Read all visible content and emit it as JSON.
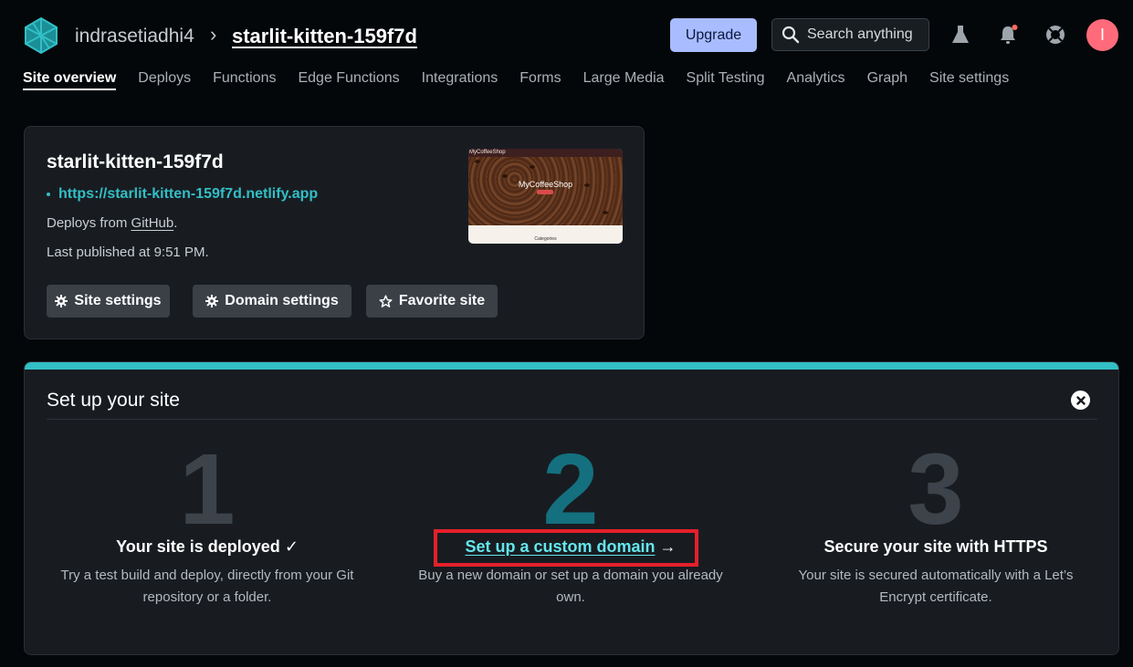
{
  "header": {
    "team_name": "indrasetiadhi4",
    "separator": "›",
    "site_name": "starlit-kitten-159f7d",
    "upgrade_label": "Upgrade",
    "search_label": "Search anything",
    "avatar_initial": "I",
    "notification_dot_color": "#ff6b5b"
  },
  "tabs": [
    {
      "label": "Site overview",
      "active": true
    },
    {
      "label": "Deploys"
    },
    {
      "label": "Functions"
    },
    {
      "label": "Edge Functions"
    },
    {
      "label": "Integrations"
    },
    {
      "label": "Forms"
    },
    {
      "label": "Large Media"
    },
    {
      "label": "Split Testing"
    },
    {
      "label": "Analytics"
    },
    {
      "label": "Graph"
    },
    {
      "label": "Site settings"
    }
  ],
  "site_card": {
    "name": "starlit-kitten-159f7d",
    "url": "https://starlit-kitten-159f7d.netlify.app",
    "deploys_from_prefix": "Deploys from",
    "deploys_from_source": "GitHub",
    "deploys_from_suffix": ".",
    "last_published": "Last published at 9:51 PM.",
    "buttons": {
      "site_settings": "Site settings",
      "domain_settings": "Domain settings",
      "favorite_site": "Favorite site"
    },
    "preview": {
      "nav_text": "MyCoffeeShop",
      "hero_title": "MyCoffeeShop",
      "section_label": "Categories"
    }
  },
  "setup": {
    "title": "Set up your site",
    "steps": [
      {
        "number": "1",
        "heading": "Your site is deployed",
        "heading_mark": "✓",
        "description": "Try a test build and deploy, directly from your Git repository or a folder."
      },
      {
        "number": "2",
        "heading": "Set up a custom domain",
        "heading_mark": "→",
        "description": "Buy a new domain or set up a domain you already own."
      },
      {
        "number": "3",
        "heading": "Secure your site with HTTPS",
        "description": "Your site is secured automatically with a Let’s Encrypt certificate."
      }
    ]
  },
  "colors": {
    "accent_teal": "#32bfc6",
    "link_teal": "#62e6ec",
    "upgrade_bg": "#a9bcff",
    "highlight_red": "#e5202b",
    "avatar_bg": "#ff6b7a"
  }
}
